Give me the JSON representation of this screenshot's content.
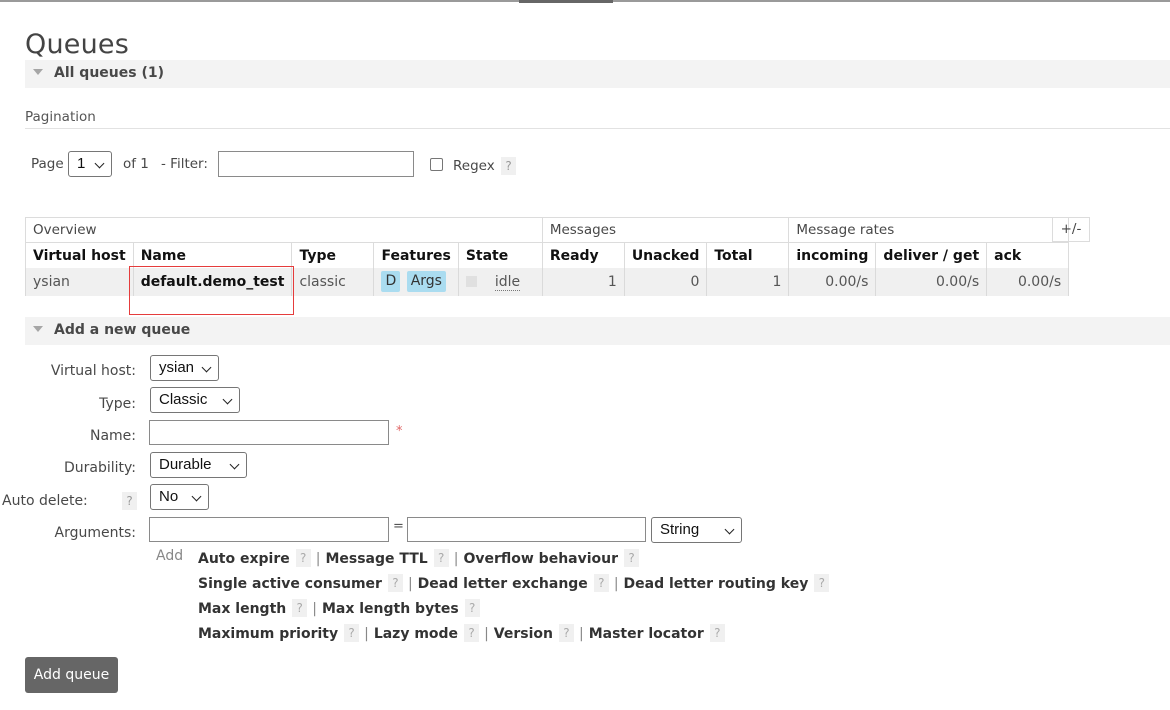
{
  "page_title": "Queues",
  "all_queues": {
    "title": "All queues (1)"
  },
  "pagination": {
    "section_label": "Pagination",
    "page_label": "Page",
    "page_value": "1",
    "of_label": "of 1",
    "filter_label": "- Filter:",
    "filter_value": "",
    "regex_label": "Regex",
    "help": "?"
  },
  "table": {
    "groups": [
      "Overview",
      "Messages",
      "Message rates"
    ],
    "toggle_columns": "+/-",
    "headers": [
      "Virtual host",
      "Name",
      "Type",
      "Features",
      "State",
      "Ready",
      "Unacked",
      "Total",
      "incoming",
      "deliver / get",
      "ack"
    ],
    "rows": [
      {
        "vhost": "ysian",
        "name": "default.demo_test",
        "type": "classic",
        "feature_d": "D",
        "feature_args": "Args",
        "state": "idle",
        "ready": "1",
        "unacked": "0",
        "total": "1",
        "incoming": "0.00/s",
        "deliver_get": "0.00/s",
        "ack": "0.00/s"
      }
    ]
  },
  "add_queue": {
    "title": "Add a new queue",
    "vhost_label": "Virtual host:",
    "vhost_value": "ysian",
    "type_label": "Type:",
    "type_value": "Classic",
    "name_label": "Name:",
    "name_value": "",
    "required_mark": "*",
    "durability_label": "Durability:",
    "durability_value": "Durable",
    "auto_delete_label": "Auto delete:",
    "auto_delete_value": "No",
    "arguments_label": "Arguments:",
    "arg_key": "",
    "arg_equals": "=",
    "arg_value": "",
    "arg_type": "String",
    "add_word": "Add",
    "arg_lines": [
      [
        "Auto expire",
        "Message TTL",
        "Overflow behaviour"
      ],
      [
        "Single active consumer",
        "Dead letter exchange",
        "Dead letter routing key"
      ],
      [
        "Max length",
        "Max length bytes"
      ],
      [
        "Maximum priority",
        "Lazy mode",
        "Version",
        "Master locator"
      ]
    ],
    "submit_label": "Add queue"
  }
}
